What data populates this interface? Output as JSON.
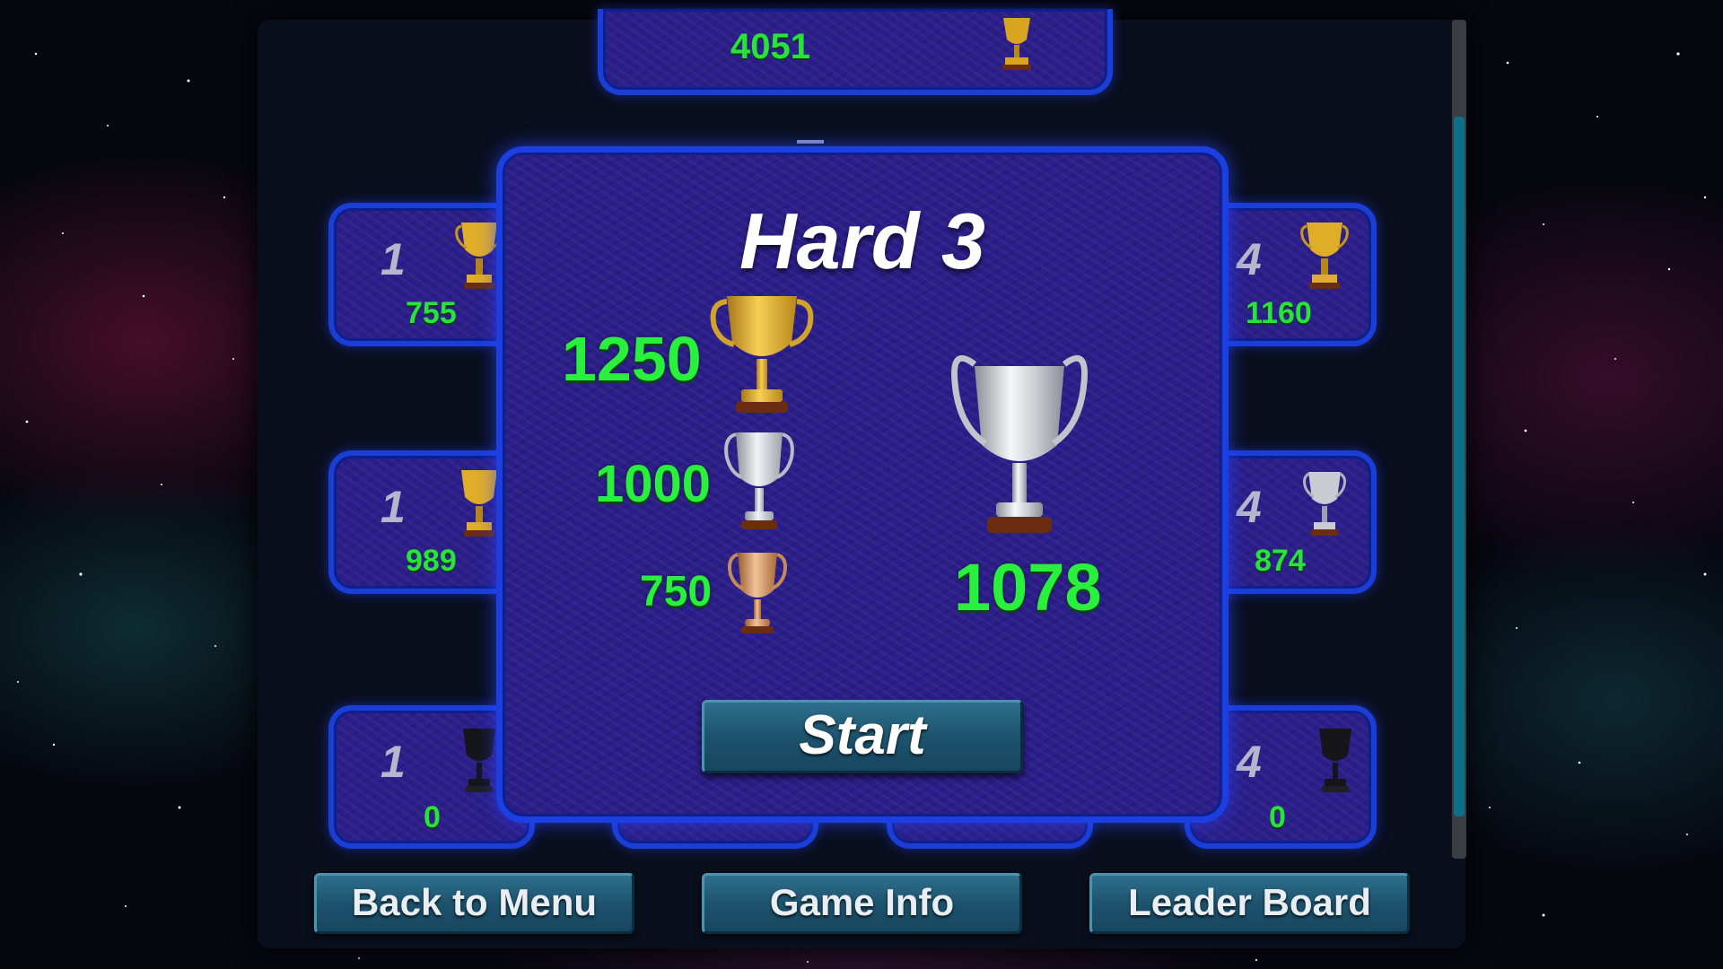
{
  "top_tile": {
    "score": "4051"
  },
  "tiles": [
    {
      "number": "1",
      "score": "755",
      "trophy": "gold-trophy"
    },
    {
      "number": "4",
      "score": "1160",
      "trophy": "gold-trophy"
    },
    {
      "number": "1",
      "score": "989",
      "trophy": "gold-trophy"
    },
    {
      "number": "4",
      "score": "874",
      "trophy": "silver-trophy"
    },
    {
      "number": "1",
      "score": "0",
      "trophy": "dark-trophy"
    },
    {
      "number": "4",
      "score": "0",
      "trophy": "dark-trophy"
    }
  ],
  "modal": {
    "title": "Hard 3",
    "gold_target": "1250",
    "silver_target": "1000",
    "bronze_target": "750",
    "current_score": "1078",
    "current_trophy": "silver-trophy",
    "start_label": "Start"
  },
  "buttons": {
    "back": "Back to Menu",
    "info": "Game Info",
    "leaderboard": "Leader Board"
  },
  "colors": {
    "score_green": "#29f03c",
    "tile_border": "#1b3fe0",
    "tile_fill": "#2b1e8a",
    "button": "#1d536d"
  }
}
